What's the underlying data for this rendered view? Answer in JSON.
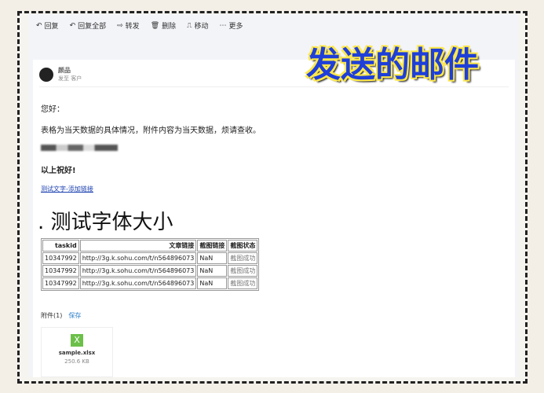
{
  "toolbar": {
    "reply": "回复",
    "reply_all": "回复全部",
    "forward": "转发",
    "delete": "删除",
    "move": "移动",
    "more": "更多"
  },
  "sender": {
    "name": "颜品",
    "to": "发至 客户"
  },
  "body": {
    "greeting": "您好：",
    "line1": "表格为当天数据的具体情况，附件内容为当天数据，烦请查收。",
    "closing": "以上祝好!",
    "link": "测试文字-添加链接",
    "big_text": "测试字体大小"
  },
  "table": {
    "headers": [
      "taskid",
      "文章链接",
      "截图链接",
      "截图状态"
    ],
    "rows": [
      [
        "10347992",
        "http://3g.k.sohu.com/t/n564896073",
        "NaN",
        "截图成功"
      ],
      [
        "10347992",
        "http://3g.k.sohu.com/t/n564896073",
        "NaN",
        "截图成功"
      ],
      [
        "10347992",
        "http://3g.k.sohu.com/t/n564896073",
        "NaN",
        "截图成功"
      ]
    ]
  },
  "attachments": {
    "label": "附件(1)",
    "save": "保存",
    "file_name": "sample.xlsx",
    "file_size": "250.6 KB",
    "file_icon": "X"
  },
  "overlay_title": "发送的邮件"
}
